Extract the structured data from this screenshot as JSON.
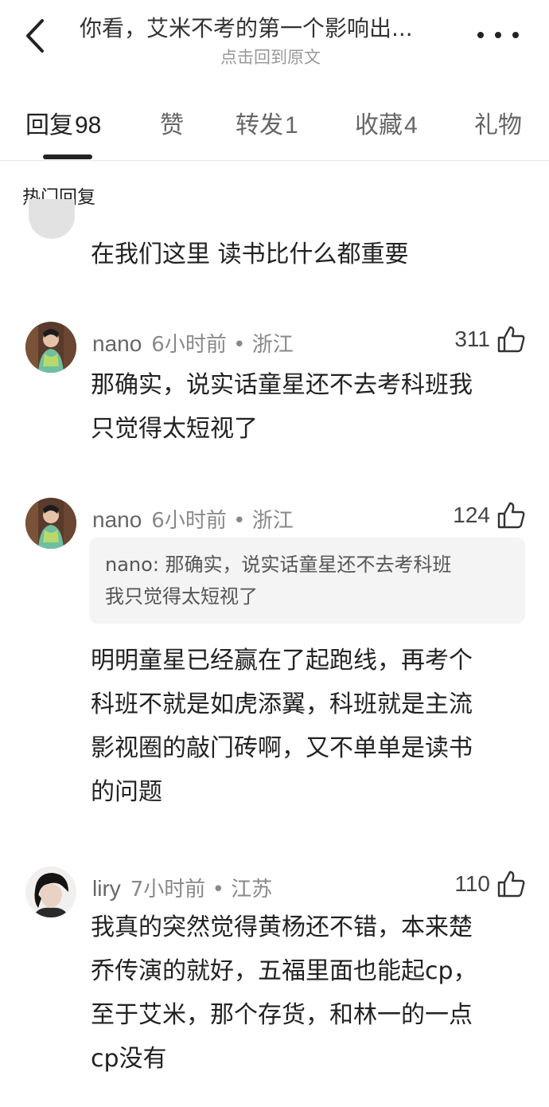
{
  "header": {
    "title": "你看，艾米不考的第一个影响出...",
    "subtitle": "点击回到原文"
  },
  "tabs": [
    {
      "label": "回复",
      "count": "98"
    },
    {
      "label": "赞",
      "count": ""
    },
    {
      "label": "转发",
      "count": "1"
    },
    {
      "label": "收藏",
      "count": "4"
    },
    {
      "label": "礼物",
      "count": ""
    }
  ],
  "section_title": "热门回复",
  "comments": [
    {
      "text": "在我们这里 读书比什么都重要"
    },
    {
      "user": "nano",
      "time": "6小时前",
      "location": "浙江",
      "likes": "311",
      "text_lines": [
        "那确实，说实话童星还不去考科班我",
        "只觉得太短视了"
      ]
    },
    {
      "user": "nano",
      "time": "6小时前",
      "location": "浙江",
      "likes": "124",
      "quote_lines": [
        "nano: 那确实，说实话童星还不去考科班",
        "我只觉得太短视了"
      ],
      "text_lines": [
        "明明童星已经赢在了起跑线，再考个",
        "科班不就是如虎添翼，科班就是主流",
        "影视圈的敲门砖啊，又不单单是读书",
        "的问题"
      ]
    },
    {
      "user": "liry",
      "time": "7小时前",
      "location": "江苏",
      "likes": "110",
      "text_lines": [
        "我真的突然觉得黄杨还不错，本来楚",
        "乔传演的就好，五福里面也能起cp，",
        "至于艾米，那个存货，和林一的一点",
        "cp没有"
      ]
    }
  ],
  "meta_sep": "•",
  "icons": {
    "back": "chevron-left-icon",
    "more": "more-dots-icon",
    "like": "thumbs-up-icon"
  }
}
